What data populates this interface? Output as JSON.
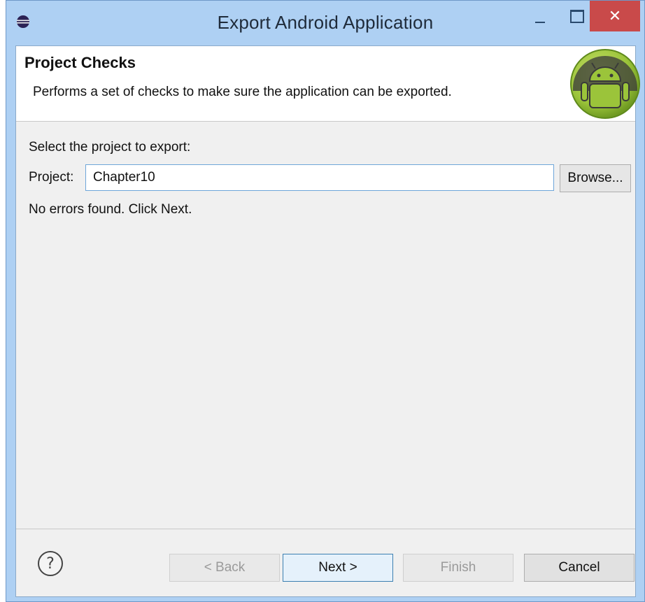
{
  "window": {
    "title": "Export Android Application",
    "close_glyph": "✕",
    "app_icon": "eclipse-icon"
  },
  "header": {
    "title": "Project Checks",
    "description": "Performs a set of checks to make sure the application can be exported.",
    "logo": "android-logo"
  },
  "form": {
    "select_label": "Select the project to export:",
    "project_label": "Project:",
    "project_value": "Chapter10",
    "browse_label": "Browse...",
    "status": "No errors found. Click Next."
  },
  "footer": {
    "help_glyph": "?",
    "back_label": "< Back",
    "next_label": "Next >",
    "finish_label": "Finish",
    "cancel_label": "Cancel"
  },
  "colors": {
    "titlebar": "#aed0f3",
    "close_button": "#c94a4a",
    "dialog_bg": "#f0f0f0",
    "focus_border": "#3c7fb1",
    "android_green": "#9bc43a"
  }
}
